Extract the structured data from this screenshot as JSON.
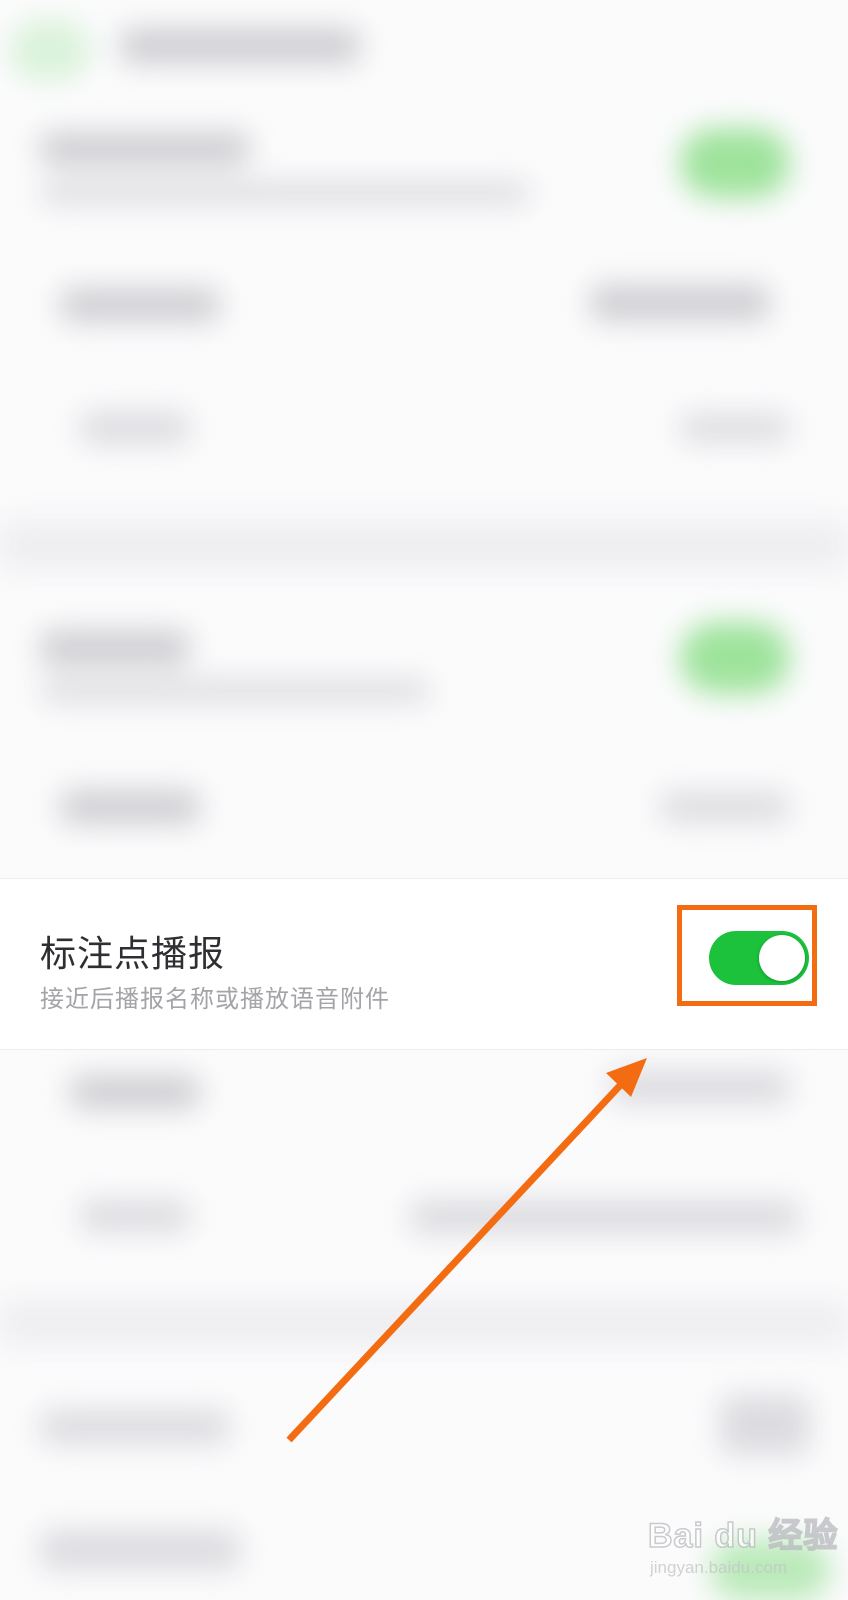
{
  "setting": {
    "title": "标注点播报",
    "subtitle": "接近后播报名称或播放语音附件",
    "toggle_state": "on",
    "toggle_color": "#1CC13C"
  },
  "annotation": {
    "highlight_color": "#F36C12",
    "arrow_color": "#F36C12"
  },
  "watermark": {
    "brand": "Bai du 经验",
    "url": "jingyan.baidu.com"
  }
}
